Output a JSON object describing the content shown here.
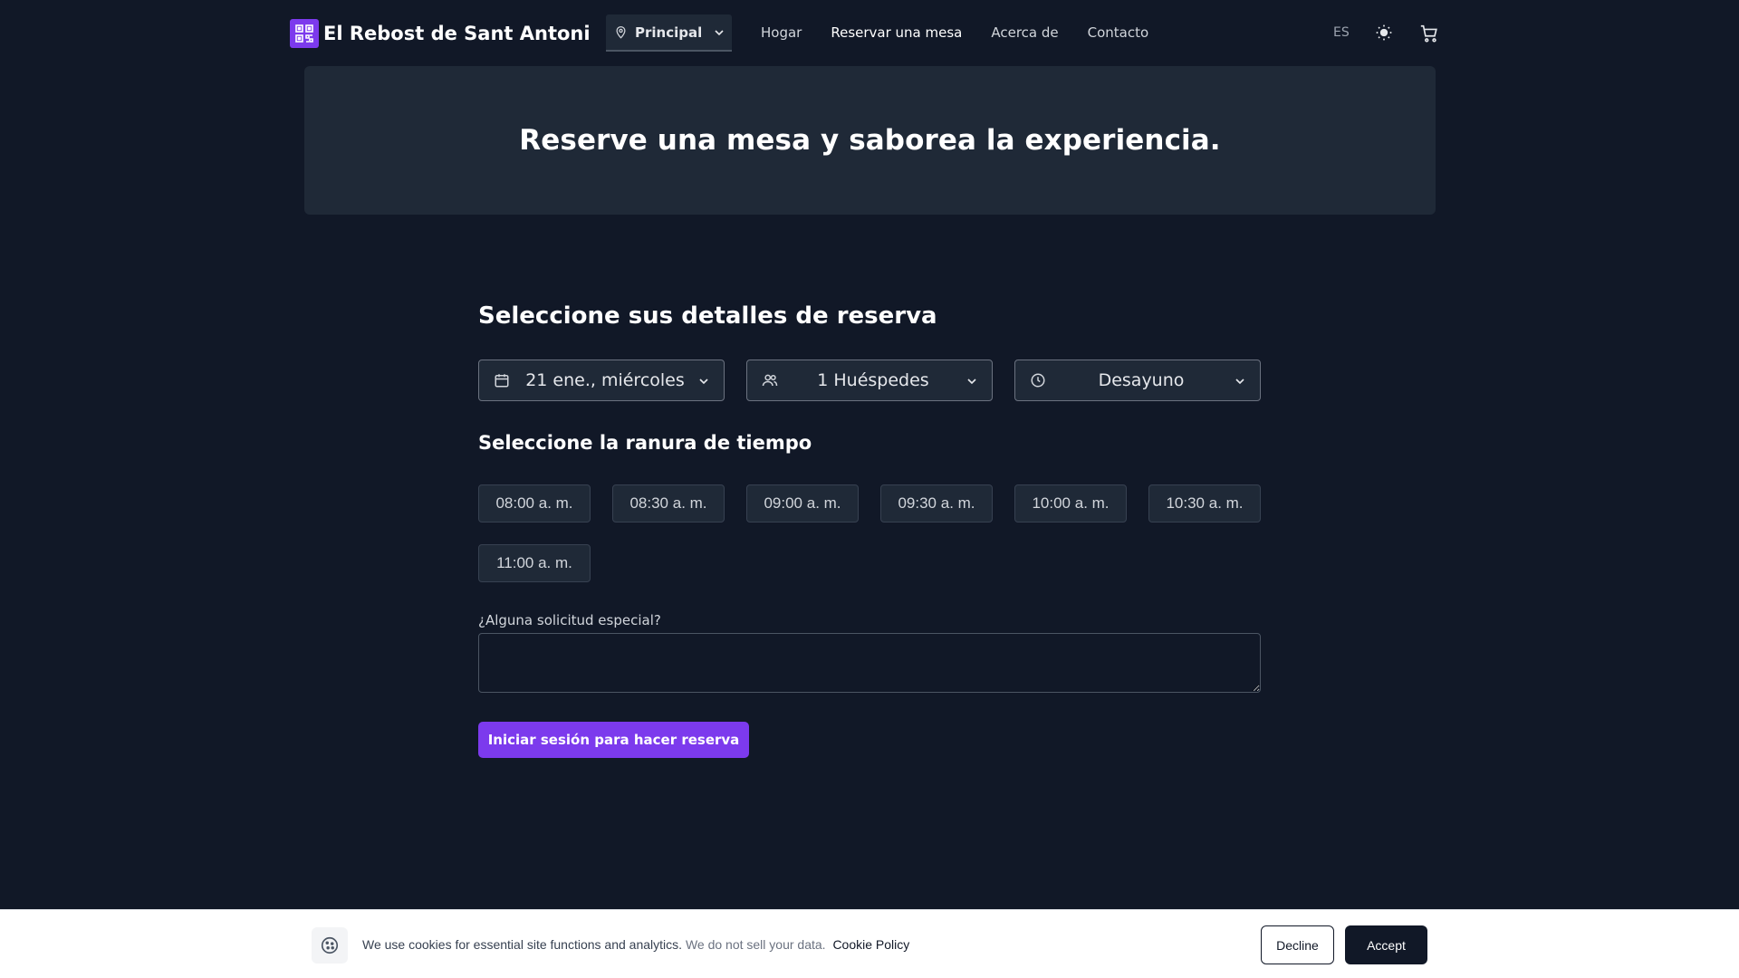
{
  "header": {
    "brand_name": "El Rebost de Sant Antoni",
    "location": "Principal",
    "nav": [
      {
        "label": "Hogar"
      },
      {
        "label": "Reservar una mesa"
      },
      {
        "label": "Acerca de"
      },
      {
        "label": "Contacto"
      }
    ],
    "language": "ES",
    "icons": [
      "qr-code-logo-icon",
      "map-pin-icon",
      "chevron-down-icon",
      "sun-icon",
      "cart-icon"
    ],
    "accent_color": "#7c3aed"
  },
  "hero": {
    "title": "Reserve una mesa y saborea la experiencia."
  },
  "booking": {
    "title": "Seleccione sus detalles de reserva",
    "date": "21 ene., miércoles",
    "guests": "1 Huéspedes",
    "meal": "Desayuno",
    "slots_title": "Seleccione la ranura de tiempo",
    "slots": [
      "08:00 a. m.",
      "08:30 a. m.",
      "09:00 a. m.",
      "09:30 a. m.",
      "10:00 a. m.",
      "10:30 a. m.",
      "11:00 a. m."
    ],
    "request_label": "¿Alguna solicitud especial?",
    "request_value": "",
    "submit_label": "Iniciar sesión para hacer reserva"
  },
  "cookie": {
    "text": "We use cookies for essential site functions and analytics.",
    "muted_text": "We do not sell your data.",
    "link": "Cookie Policy",
    "decline": "Decline",
    "accept": "Accept"
  }
}
